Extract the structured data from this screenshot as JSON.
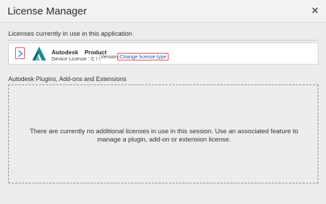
{
  "window": {
    "title": "License Manager",
    "close_icon": "close-icon"
  },
  "in_use": {
    "label": "Licenses currently in use in this application",
    "license": {
      "vendor": "Autodesk",
      "product": "Product",
      "device_license": "Device License : C \\ \\",
      "version_label": "Version",
      "change_link": "Change license type",
      "logo_icon": "autodesk-logo-icon",
      "expand_icon": "chevron-right-icon"
    }
  },
  "plugins": {
    "label": "Autodesk Plugins, Add-ons and Extensions",
    "empty_message": "There are currently no additional licenses in use in this session. Use an associated feature to manage a plugin, add-on or extension license."
  },
  "colors": {
    "accent": "#1a56b8",
    "highlight_border": "#e05050",
    "logo_teal": "#1d8a8c"
  }
}
